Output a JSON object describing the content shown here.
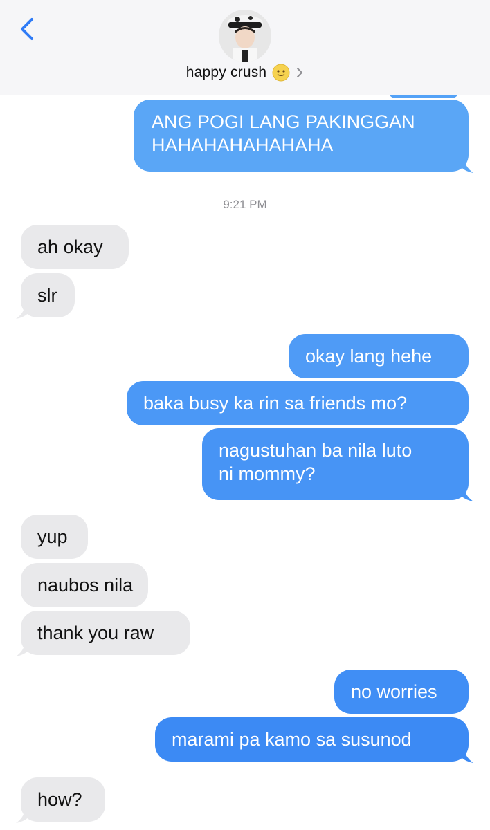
{
  "header": {
    "contact_name": "happy crush",
    "back_icon": "chevron-left-icon",
    "details_icon": "chevron-right-icon",
    "emoji": "smiling-face-emoji"
  },
  "thread": {
    "timestamp": "9:21 PM",
    "messages": [
      {
        "from": "me",
        "line1": "ANG POGI LANG PAKINGGAN",
        "line2": "HAHAHAHAHAHAHA"
      },
      {
        "from": "them",
        "text": "ah okay"
      },
      {
        "from": "them",
        "text": "slr"
      },
      {
        "from": "me",
        "text": "okay lang hehe"
      },
      {
        "from": "me",
        "text": "baka busy ka rin sa friends mo?"
      },
      {
        "from": "me",
        "line1": "nagustuhan ba nila luto",
        "line2": "ni mommy?"
      },
      {
        "from": "them",
        "text": "yup"
      },
      {
        "from": "them",
        "text": "naubos nila"
      },
      {
        "from": "them",
        "text": "thank you raw"
      },
      {
        "from": "me",
        "text": "no worries"
      },
      {
        "from": "me",
        "text": "marami pa kamo sa susunod"
      },
      {
        "from": "them",
        "text": "how?"
      }
    ]
  },
  "colors": {
    "sent_bubble": "#3f8df5",
    "received_bubble": "#e9e9eb",
    "header_bg": "#f6f6f8",
    "accent": "#2f7bf6"
  }
}
